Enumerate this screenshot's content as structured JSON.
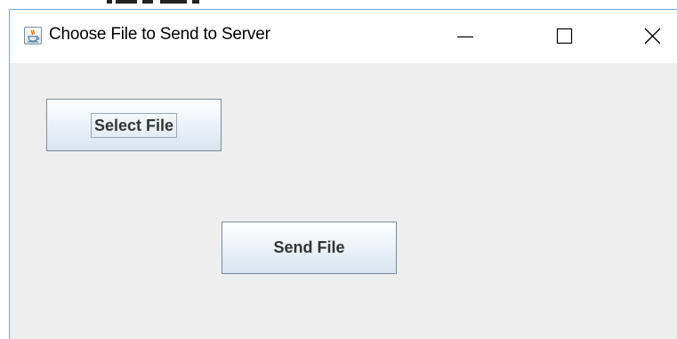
{
  "window": {
    "title": "Choose File to Send to Server",
    "icon": "java-cup-icon",
    "controls": {
      "minimize": "minimize-icon",
      "maximize": "maximize-icon",
      "close": "close-icon"
    }
  },
  "content": {
    "select_button_label": "Select File",
    "send_button_label": "Send File"
  },
  "colors": {
    "background": "#eeeeee",
    "titlebar": "#ffffff",
    "window_border": "#6fa7d8",
    "button_border": "#7a8a99",
    "button_text": "#333333"
  }
}
